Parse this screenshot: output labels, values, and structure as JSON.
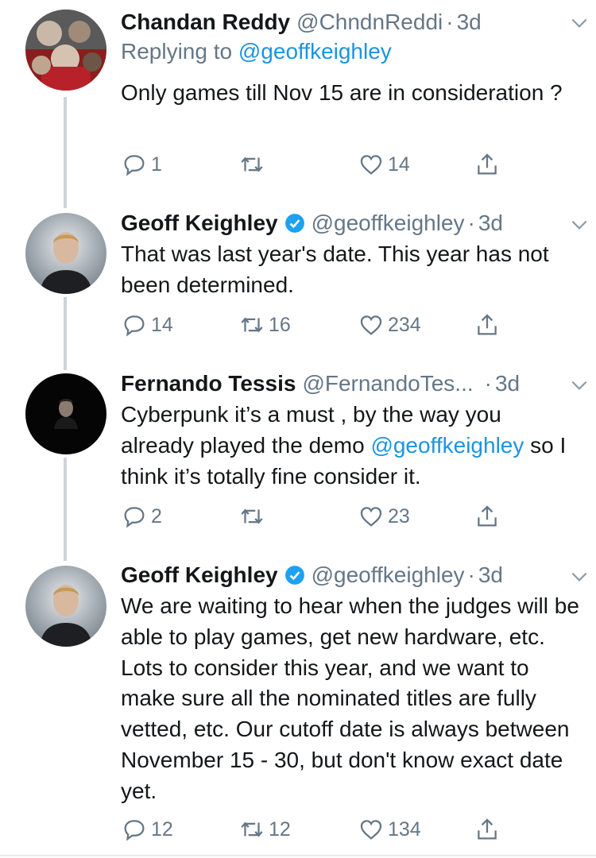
{
  "tweets": [
    {
      "name": "Chandan Reddy",
      "handle": "@ChndnReddi",
      "separator": "·",
      "time": "3d",
      "replying_prefix": "Replying to ",
      "replying_to": "@geoffkeighley",
      "text": "Only games till Nov 15 are in consideration ?",
      "replies": "1",
      "retweets": "",
      "likes": "14",
      "verified": false
    },
    {
      "name": "Geoff Keighley",
      "handle": "@geoffkeighley",
      "separator": "·",
      "time": "3d",
      "text": "That was last year's date. This year has not been determined.",
      "replies": "14",
      "retweets": "16",
      "likes": "234",
      "verified": true
    },
    {
      "name": "Fernando Tessis",
      "handle": "@FernandoTes...",
      "separator": "·",
      "time": "3d",
      "text_before": "Cyberpunk it’s a must , by the way you already played the demo ",
      "mention": "@geoffkeighley",
      "text_after": " so I think it’s totally fine consider it.",
      "replies": "2",
      "retweets": "",
      "likes": "23",
      "verified": false
    },
    {
      "name": "Geoff Keighley",
      "handle": "@geoffkeighley",
      "separator": "·",
      "time": "3d",
      "text": "We are waiting to hear when the judges will be able to play games, get new hardware, etc. Lots to consider this year, and we want to make sure all the nominated titles are fully vetted, etc. Our cutoff date is always between November 15 - 30, but don't know exact date yet.",
      "replies": "12",
      "retweets": "12",
      "likes": "134",
      "verified": true
    }
  ],
  "colors": {
    "accent": "#1b95e0",
    "verified": "#1da1f2",
    "secondary_text": "#657786",
    "thread_line": "#cdd4da"
  },
  "icons": [
    "reply-icon",
    "retweet-icon",
    "like-icon",
    "share-icon",
    "chevron-down-icon",
    "verified-badge-icon"
  ]
}
